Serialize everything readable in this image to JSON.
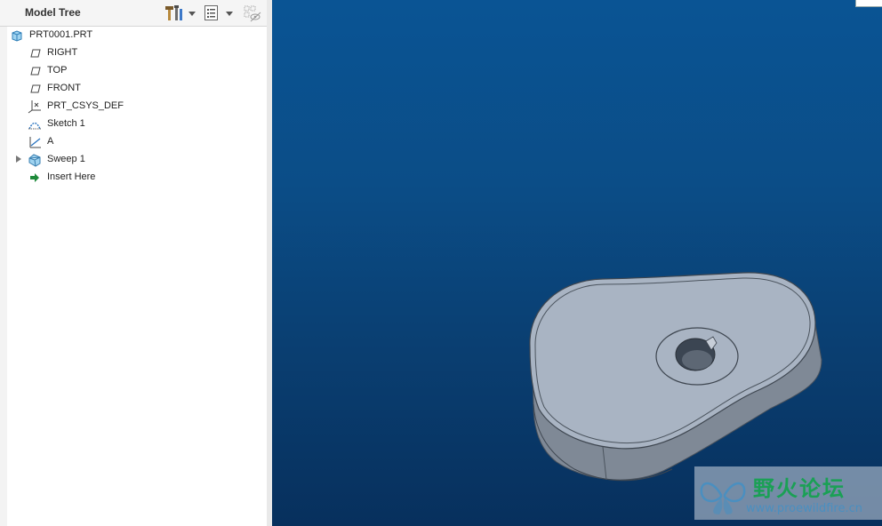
{
  "model_tree": {
    "title": "Model Tree",
    "items": [
      {
        "label": "PRT0001.PRT",
        "icon": "part-icon"
      },
      {
        "label": "RIGHT",
        "icon": "datum-plane-icon"
      },
      {
        "label": "TOP",
        "icon": "datum-plane-icon"
      },
      {
        "label": "FRONT",
        "icon": "datum-plane-icon"
      },
      {
        "label": "PRT_CSYS_DEF",
        "icon": "coordinate-system-icon"
      },
      {
        "label": "Sketch 1",
        "icon": "sketch-icon"
      },
      {
        "label": "A",
        "icon": "datum-axis-icon"
      },
      {
        "label": "Sweep 1",
        "icon": "sweep-icon",
        "collapsed": true
      },
      {
        "label": "Insert Here",
        "icon": "insert-arrow-icon"
      }
    ]
  },
  "watermark": {
    "title": "野火论坛",
    "url": "www.proewildfire.cn"
  },
  "colors": {
    "viewport_top": "#0a5494",
    "viewport_bottom": "#07305d",
    "model_face": "#a9b4c3",
    "model_side": "#7f8996",
    "watermark_green": "#1aa055"
  }
}
